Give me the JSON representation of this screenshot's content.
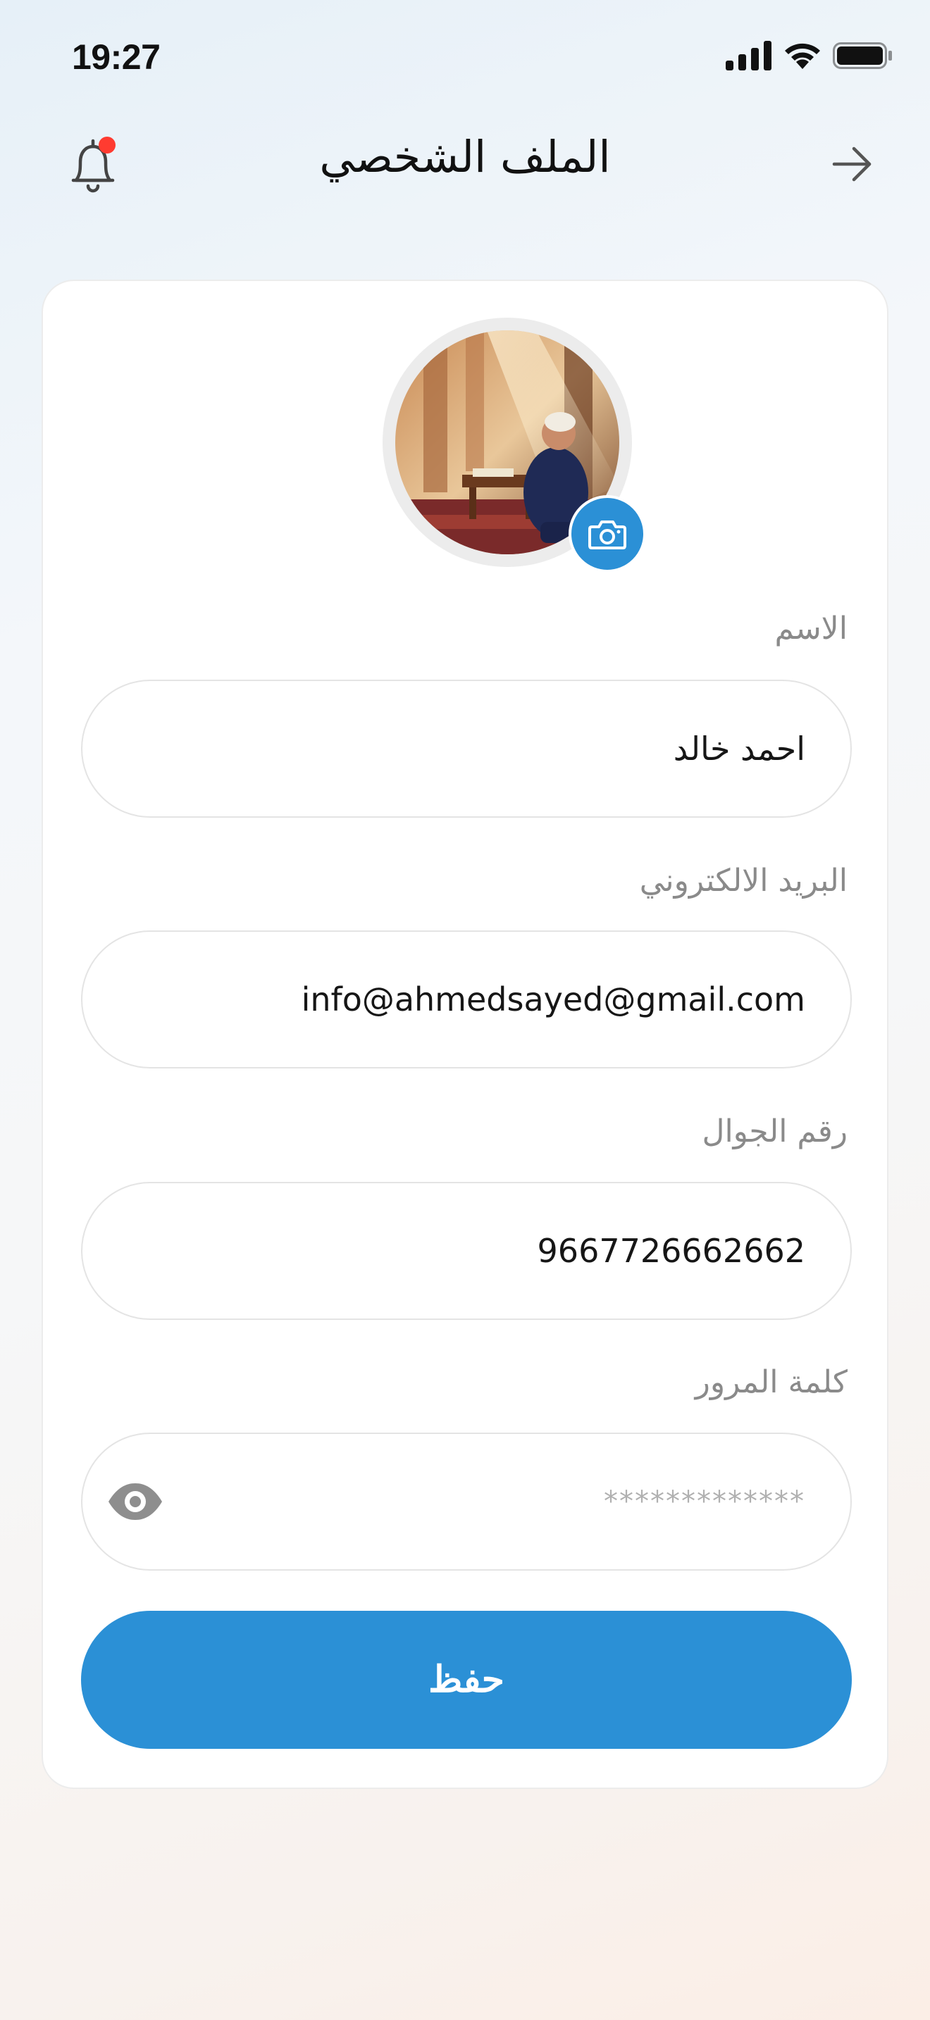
{
  "status_bar": {
    "time": "19:27",
    "icons": [
      "cellular-signal-icon",
      "wifi-icon",
      "battery-icon"
    ]
  },
  "header": {
    "title": "الملف الشخصي",
    "notification_icon": "bell-icon",
    "back_icon": "arrow-right-icon"
  },
  "profile": {
    "avatar_alt": "profile-photo",
    "camera_icon": "camera-icon"
  },
  "form": {
    "name": {
      "label": "الاسم",
      "value": "احمد خالد"
    },
    "email": {
      "label": "البريد الالكتروني",
      "value": "info@ahmedsayed@gmail.com"
    },
    "phone": {
      "label": "رقم الجوال",
      "value": "9667726662662"
    },
    "password": {
      "label": "كلمة المرور",
      "value": "*************",
      "toggle_icon": "eye-icon"
    },
    "save_label": "حفظ"
  },
  "colors": {
    "accent": "#2b90d6",
    "notification_dot": "#ff3b30",
    "label_text": "#8a8a8a"
  }
}
